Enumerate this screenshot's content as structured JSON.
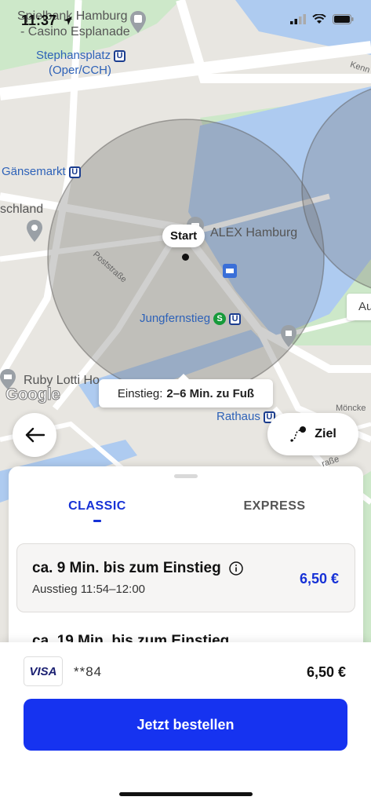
{
  "status_bar": {
    "time": "11:37"
  },
  "map": {
    "labels": {
      "spielbank_line1": "Spielbank Hamburg",
      "spielbank_line2": "- Casino Esplanade",
      "stephansplatz_line1": "Stephansplatz",
      "stephansplatz_line2": "(Oper/CCH)",
      "gaensemarkt": "Gänsemarkt",
      "schland": "schland",
      "poststrasse": "Poststraße",
      "alex": "ALEX Hamburg",
      "jungfernstieg": "Jungfernstieg",
      "ruby": "Ruby Lotti Ho",
      "rathaus": "Rathaus",
      "moenckeberg": "Möncke",
      "strasse": "raße",
      "kenn": "Kenn",
      "au": "Au",
      "u_badge": "U",
      "s_badge": "S"
    },
    "start_pin_label": "Start",
    "boarding_prefix": "Einstieg:",
    "boarding_time": "2–6 Min. zu Fuß",
    "google_logo": "Google",
    "ziel_label": "Ziel"
  },
  "sheet": {
    "tabs": [
      {
        "label": "CLASSIC"
      },
      {
        "label": "EXPRESS"
      }
    ],
    "options": [
      {
        "title": "ca. 9 Min. bis zum Einstieg",
        "subtitle": "Ausstieg 11:54–12:00",
        "price": "6,50 €"
      },
      {
        "title": "ca. 19 Min. bis zum Einstieg"
      }
    ]
  },
  "footer": {
    "card_brand": "VISA",
    "card_digits": "**84",
    "total": "6,50 €",
    "order_button": "Jetzt bestellen"
  },
  "colors": {
    "accent": "#1633f0",
    "price": "#1631d6"
  }
}
